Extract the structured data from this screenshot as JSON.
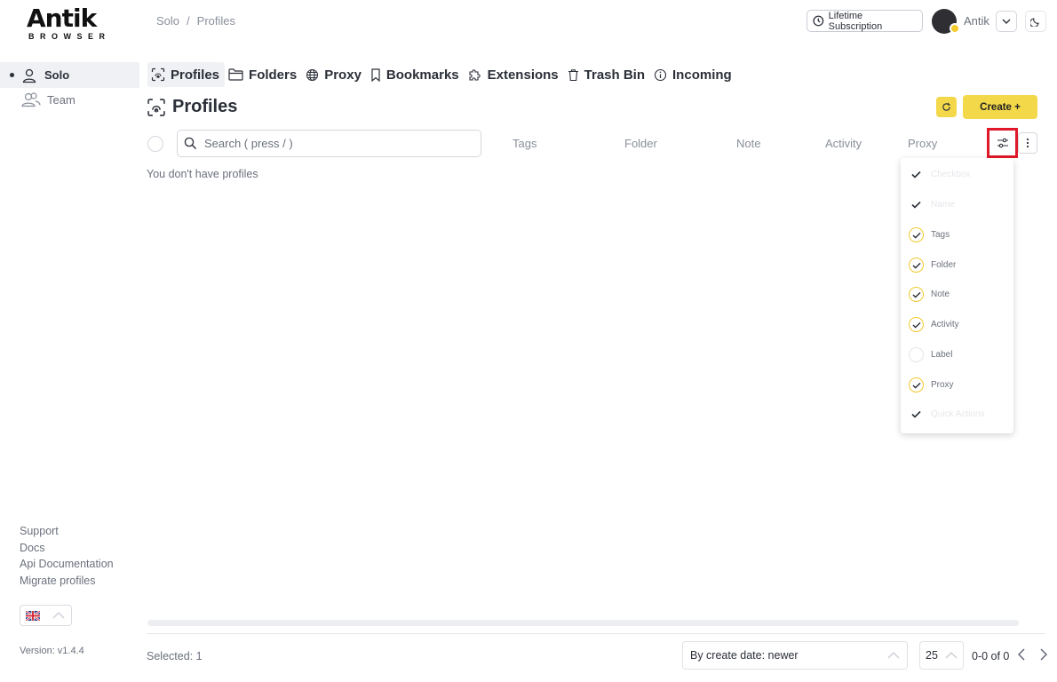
{
  "logo": {
    "main": "Antik",
    "sub": "BROWSER"
  },
  "breadcrumb": {
    "first": "Solo",
    "separator": "/",
    "current": "Profiles"
  },
  "topbar": {
    "subscription_label": "Lifetime Subscription",
    "username": "Antik"
  },
  "sidebar": {
    "items": [
      {
        "label": "Solo",
        "active": true
      },
      {
        "label": "Team",
        "active": false
      }
    ],
    "links": [
      "Support",
      "Docs",
      "Api Documentation",
      "Migrate profiles"
    ],
    "version": "Version: v1.4.4"
  },
  "tabs": [
    {
      "label": "Profiles",
      "icon": "fingerprint-icon",
      "active": true
    },
    {
      "label": "Folders",
      "icon": "folder-icon"
    },
    {
      "label": "Proxy",
      "icon": "globe-icon"
    },
    {
      "label": "Bookmarks",
      "icon": "bookmark-icon"
    },
    {
      "label": "Extensions",
      "icon": "puzzle-icon"
    },
    {
      "label": "Trash Bin",
      "icon": "trash-icon"
    },
    {
      "label": "Incoming",
      "icon": "info-icon"
    }
  ],
  "main": {
    "title": "Profiles",
    "create_label": "Create +",
    "search_placeholder": "Search ( press / )",
    "columns": [
      "Tags",
      "Folder",
      "Note",
      "Activity",
      "Proxy"
    ],
    "empty_text": "You don't have profiles"
  },
  "column_menu": [
    {
      "label": "Checkbox",
      "state": "disabled"
    },
    {
      "label": "Name",
      "state": "disabled"
    },
    {
      "label": "Tags",
      "state": "on"
    },
    {
      "label": "Folder",
      "state": "on"
    },
    {
      "label": "Note",
      "state": "on"
    },
    {
      "label": "Activity",
      "state": "on"
    },
    {
      "label": "Label",
      "state": "off"
    },
    {
      "label": "Proxy",
      "state": "on"
    },
    {
      "label": "Quick Actions",
      "state": "disabled"
    }
  ],
  "footer": {
    "selected": "Selected: 1",
    "sort": "By create date: newer",
    "per_page": "25",
    "range": "0-0 of 0"
  },
  "colors": {
    "accent": "#f3d84a",
    "highlight": "#e0192a"
  }
}
